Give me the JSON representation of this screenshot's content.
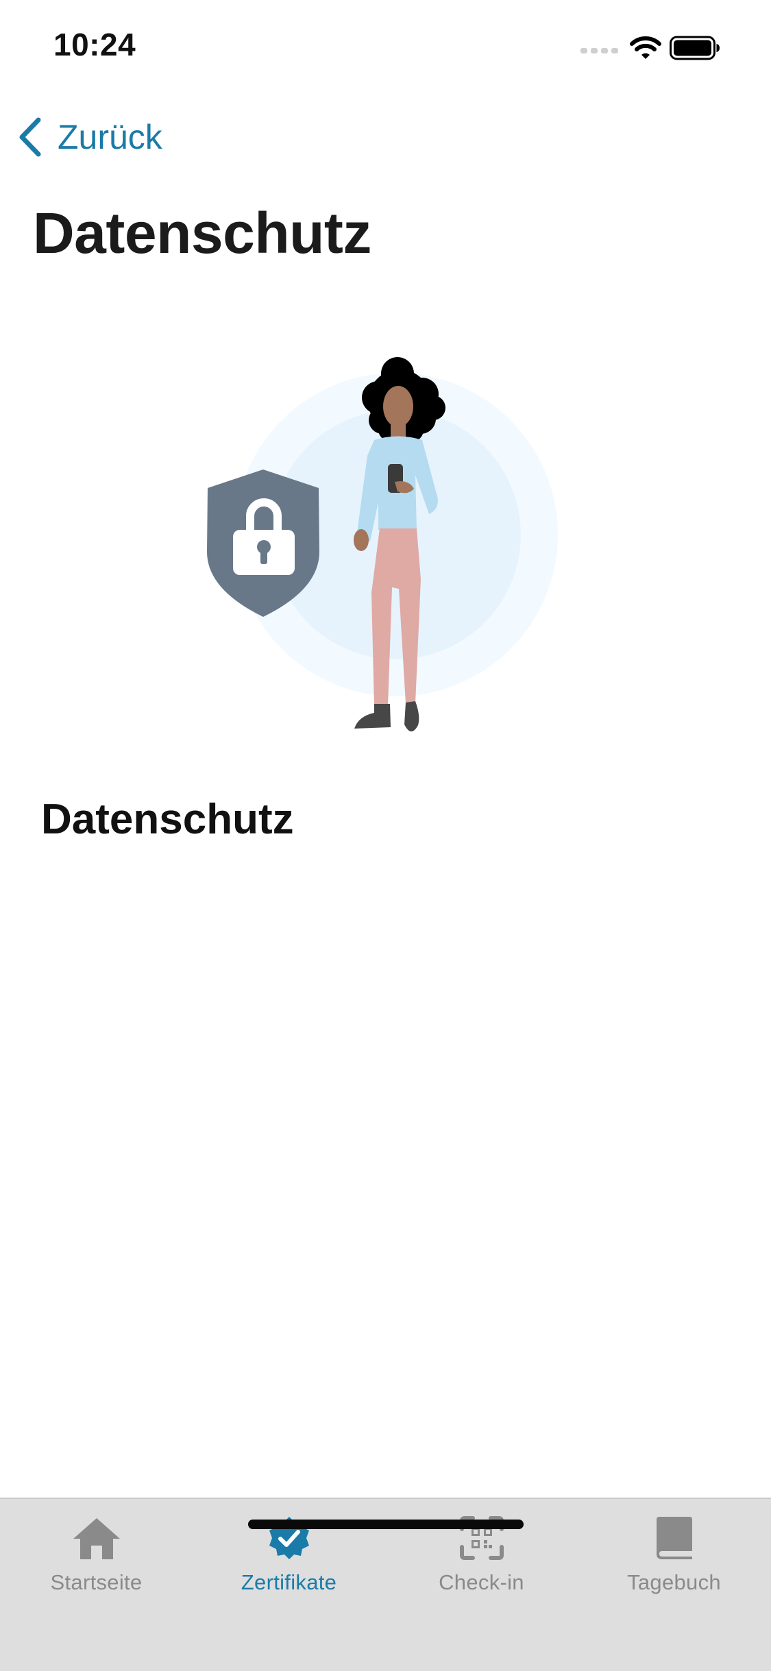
{
  "status_bar": {
    "time": "10:24"
  },
  "nav": {
    "back_label": "Zurück"
  },
  "page": {
    "title": "Datenschutz",
    "section_heading": "Datenschutz"
  },
  "tab_bar": {
    "active_tab": "Zertifikate",
    "tabs": [
      {
        "label": "Startseite",
        "icon": "house-icon"
      },
      {
        "label": "Zertifikate",
        "icon": "certificate-badge-icon"
      },
      {
        "label": "Check-in",
        "icon": "qr-scan-icon"
      },
      {
        "label": "Tagebuch",
        "icon": "book-icon"
      }
    ]
  },
  "colors": {
    "accent": "#1a7ba8",
    "tab_inactive": "#8a8a8a",
    "tab_bar_bg": "#dedede",
    "shield": "#687889"
  }
}
